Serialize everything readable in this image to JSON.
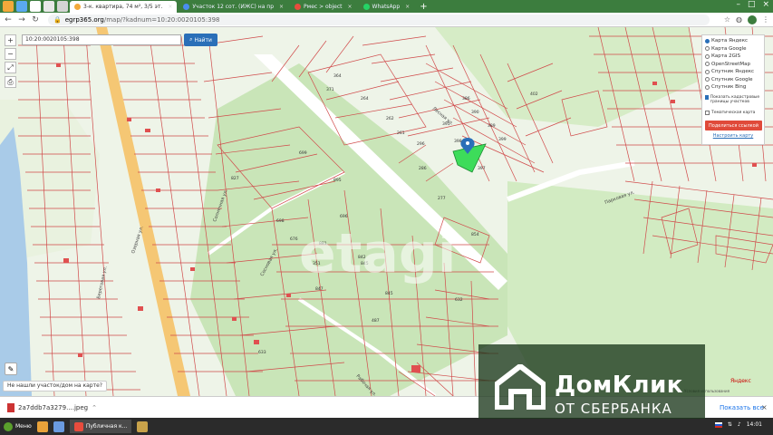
{
  "browser": {
    "tabs": [
      {
        "label": "3-к. квартира, 74 м², 3/5 эт.",
        "color": "#f3a93b"
      },
      {
        "label": "Участок 12 сот. (ИЖС) на пр",
        "color": "#4a8df0"
      },
      {
        "label": "Рмес > object",
        "color": "#e84c3d"
      },
      {
        "label": "WhatsApp",
        "color": "#25d366"
      }
    ],
    "active_tab": 0,
    "url_host": "egrp365.org",
    "url_path": "/map/?kadnum=10:20:0020105:398"
  },
  "map": {
    "search_value": "10:20:0020105:398",
    "find_label": "Найти",
    "layers": [
      {
        "label": "Карта Яндекс",
        "selected": true
      },
      {
        "label": "Карта Google",
        "selected": false
      },
      {
        "label": "Карта 2GIS",
        "selected": false
      },
      {
        "label": "OpenStreetMap",
        "selected": false
      },
      {
        "label": "Спутник Яндекс",
        "selected": false
      },
      {
        "label": "Спутник Google",
        "selected": false
      },
      {
        "label": "Спутник Bing",
        "selected": false
      }
    ],
    "checkboxes": [
      {
        "label": "Показать кадастровые границы участков",
        "checked": true
      },
      {
        "label": "Тематическая карта",
        "checked": false
      }
    ],
    "share_label": "Поделиться ссылкой",
    "setup_label": "Настроить карту",
    "not_found_label": "Не нашли участок/дом на карте?",
    "yandex_label": "Яндекс",
    "terms_label": "Условия использования",
    "street_labels": [
      "Озерная ул.",
      "Береговая ул.",
      "Солнечная ул.",
      "Рабочая ул.",
      "Лесная ул.",
      "Сосновая ул.",
      "Парковая ул."
    ],
    "parcel_numbers": [
      "398",
      "395",
      "397",
      "399",
      "389",
      "386",
      "262",
      "390",
      "261",
      "296",
      "264",
      "371",
      "286",
      "277",
      "854",
      "842",
      "845",
      "881",
      "847",
      "487",
      "632",
      "827",
      "699",
      "895",
      "696",
      "698",
      "676",
      "633",
      "351",
      "364",
      "845",
      "402"
    ],
    "accent": "#2a6fb8",
    "parcel_highlight": "#3ddc5a",
    "parcel_border": "#d04a4a"
  },
  "downloads": {
    "file_name": "2a7ddb7a3279....jpeg",
    "show_all": "Показать все"
  },
  "taskbar": {
    "menu_label": "Меню",
    "task_label": "Публичная к...",
    "time": "14:01"
  },
  "watermark": {
    "title": "ДомКлик",
    "subtitle": "ОТ СБЕРБАНКА"
  }
}
